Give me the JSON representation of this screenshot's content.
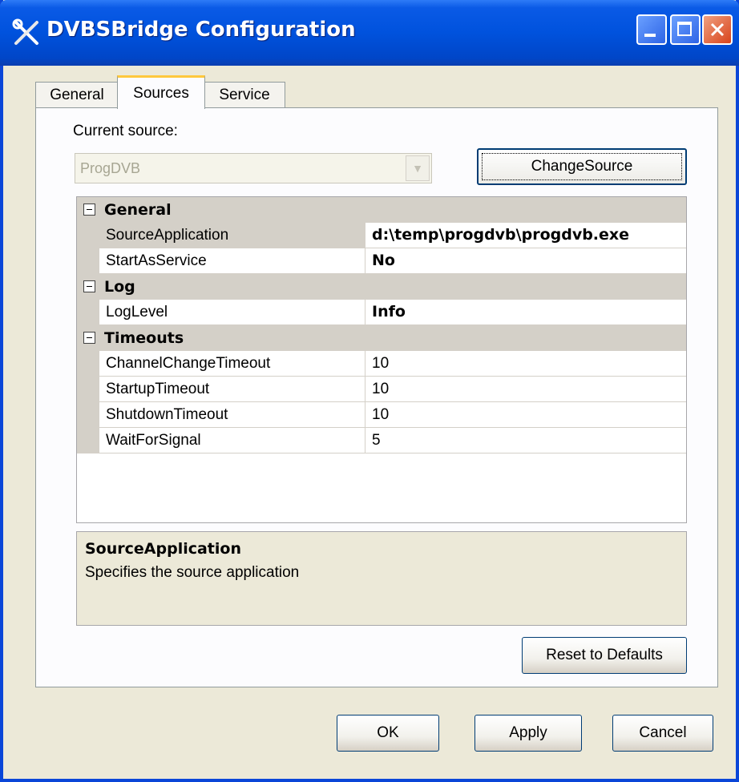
{
  "window": {
    "title": "DVBSBridge Configuration"
  },
  "tabs": [
    {
      "label": "General"
    },
    {
      "label": "Sources"
    },
    {
      "label": "Service"
    }
  ],
  "sources": {
    "current_source_label": "Current source:",
    "current_source_value": "ProgDVB",
    "change_source_label": "ChangeSource"
  },
  "property_grid": {
    "categories": [
      {
        "label": "General",
        "props": [
          {
            "name": "SourceApplication",
            "value": "d:\\temp\\progdvb\\progdvb.exe"
          },
          {
            "name": "StartAsService",
            "value": "No"
          }
        ]
      },
      {
        "label": "Log",
        "props": [
          {
            "name": "LogLevel",
            "value": "Info"
          }
        ]
      },
      {
        "label": "Timeouts",
        "props": [
          {
            "name": "ChannelChangeTimeout",
            "value": "10"
          },
          {
            "name": "StartupTimeout",
            "value": "10"
          },
          {
            "name": "ShutdownTimeout",
            "value": "10"
          },
          {
            "name": "WaitForSignal",
            "value": "5"
          }
        ]
      }
    ]
  },
  "help": {
    "title": "SourceApplication",
    "description": "Specifies the source application"
  },
  "buttons": {
    "reset": "Reset to Defaults",
    "ok": "OK",
    "apply": "Apply",
    "cancel": "Cancel"
  },
  "colors": {
    "titlebar": "#0052DD",
    "dialog_bg": "#ECE9D8",
    "grid_category_bg": "#D4D0C8"
  }
}
